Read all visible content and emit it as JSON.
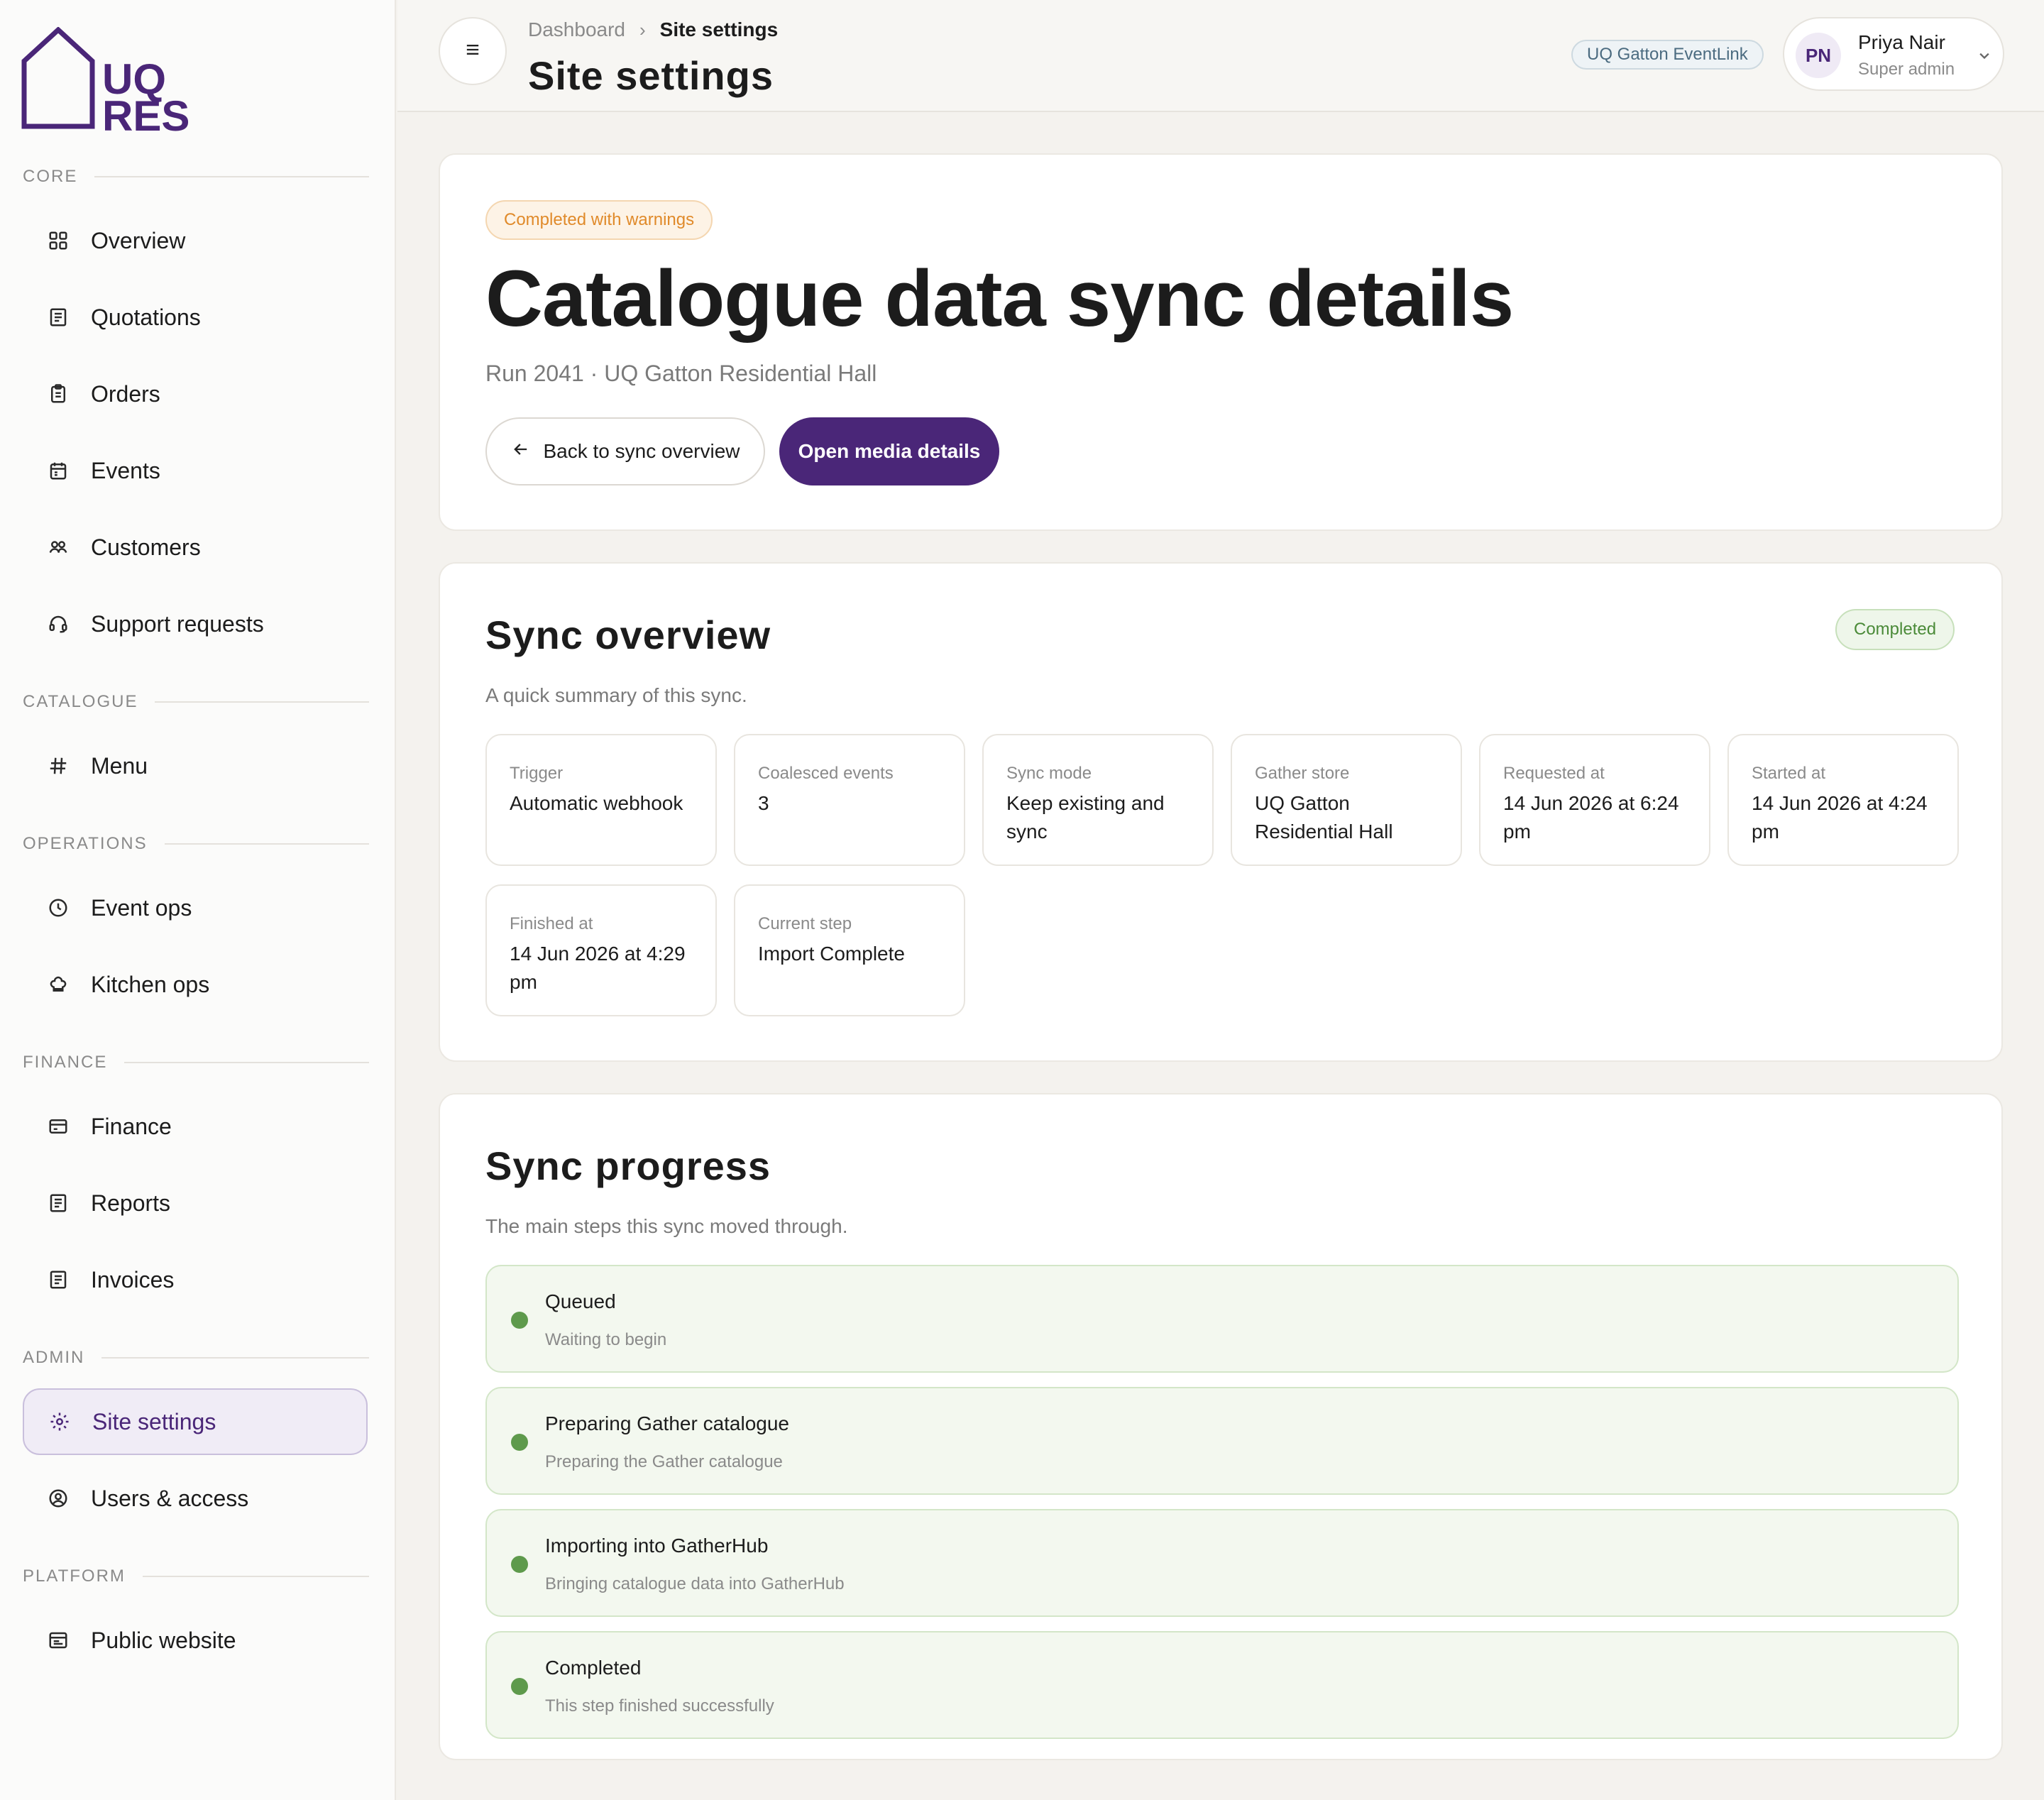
{
  "brand": {
    "logo_line1": "UQ",
    "logo_line2": "RES",
    "accent": "#4a2678"
  },
  "sidebar": {
    "sections": [
      {
        "label": "CORE"
      },
      {
        "label": "CATALOGUE"
      },
      {
        "label": "OPERATIONS"
      },
      {
        "label": "FINANCE"
      },
      {
        "label": "ADMIN"
      },
      {
        "label": "PLATFORM"
      }
    ],
    "items": [
      {
        "label": "Overview",
        "icon": "grid-icon"
      },
      {
        "label": "Quotations",
        "icon": "document-icon"
      },
      {
        "label": "Orders",
        "icon": "clipboard-icon"
      },
      {
        "label": "Events",
        "icon": "calendar-icon"
      },
      {
        "label": "Customers",
        "icon": "users-icon"
      },
      {
        "label": "Support requests",
        "icon": "headset-icon"
      },
      {
        "label": "Menu",
        "icon": "hash-icon"
      },
      {
        "label": "Event ops",
        "icon": "clock-icon"
      },
      {
        "label": "Kitchen ops",
        "icon": "chef-hat-icon"
      },
      {
        "label": "Finance",
        "icon": "card-icon"
      },
      {
        "label": "Reports",
        "icon": "document-icon"
      },
      {
        "label": "Invoices",
        "icon": "document-icon"
      },
      {
        "label": "Site settings",
        "icon": "gear-icon",
        "active": true
      },
      {
        "label": "Users & access",
        "icon": "user-circle-icon"
      },
      {
        "label": "Public website",
        "icon": "browser-icon"
      }
    ]
  },
  "topbar": {
    "breadcrumb": [
      "Dashboard",
      "Site settings"
    ],
    "title": "Site settings",
    "site_badge": "UQ Gatton EventLink",
    "user": {
      "initials": "PN",
      "name": "Priya Nair",
      "role": "Super admin"
    }
  },
  "hero": {
    "status": "Completed with warnings",
    "title": "Catalogue data sync details",
    "subtitle": "Run 2041 · UQ Gatton Residential Hall",
    "back_label": "Back to sync overview",
    "media_label": "Open media details"
  },
  "overview": {
    "title": "Sync overview",
    "subtitle": "A quick summary of this sync.",
    "status": "Completed",
    "stats": [
      {
        "label": "Trigger",
        "value": "Automatic webhook"
      },
      {
        "label": "Coalesced events",
        "value": "3"
      },
      {
        "label": "Sync mode",
        "value": "Keep existing and sync"
      },
      {
        "label": "Gather store",
        "value": "UQ Gatton Residential Hall"
      },
      {
        "label": "Requested at",
        "value": "14 Jun 2026 at 6:24 pm"
      },
      {
        "label": "Started at",
        "value": "14 Jun 2026 at 4:24 pm"
      },
      {
        "label": "Finished at",
        "value": "14 Jun 2026 at 4:29 pm"
      },
      {
        "label": "Current step",
        "value": "Import Complete"
      }
    ]
  },
  "progress": {
    "title": "Sync progress",
    "subtitle": "The main steps this sync moved through.",
    "steps": [
      {
        "title": "Queued",
        "desc": "Waiting to begin"
      },
      {
        "title": "Preparing Gather catalogue",
        "desc": "Preparing the Gather catalogue"
      },
      {
        "title": "Importing into GatherHub",
        "desc": "Bringing catalogue data into GatherHub"
      },
      {
        "title": "Completed",
        "desc": "This step finished successfully"
      }
    ]
  }
}
